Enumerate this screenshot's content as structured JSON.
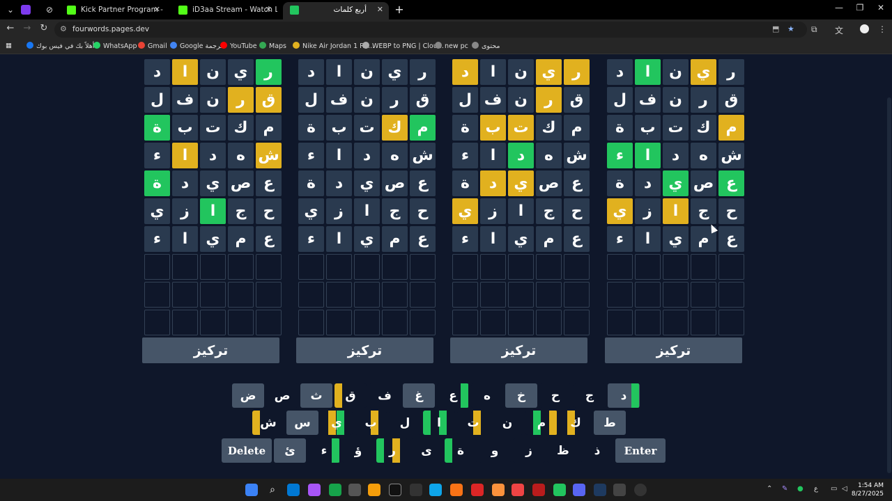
{
  "browser": {
    "tabs": [
      {
        "title": "Kick Partner Program - Kick Da",
        "active": false,
        "favicon_color": "#53fc18"
      },
      {
        "title": "iD3aa Stream - Watch Live on K",
        "active": false,
        "favicon_color": "#53fc18"
      },
      {
        "title": "أربع كلمات",
        "active": true,
        "favicon_color": "#22c55e"
      }
    ],
    "url": "fourwords.pages.dev",
    "bookmarks": [
      {
        "label": "أهلاً بك في فيس بوك",
        "color": "#1877f2"
      },
      {
        "label": "WhatsApp",
        "color": "#25d366"
      },
      {
        "label": "Gmail",
        "color": "#ea4335"
      },
      {
        "label": "Google ترجمة",
        "color": "#4285f4"
      },
      {
        "label": "YouTube",
        "color": "#ff0000"
      },
      {
        "label": "Maps",
        "color": "#34a853"
      },
      {
        "label": "Nike Air Jordan 1 Re...",
        "color": "#e1b11f"
      },
      {
        "label": "WEBP to PNG | Clou...",
        "color": "#aaaaaa"
      },
      {
        "label": "new pc",
        "color": "#888888"
      },
      {
        "label": "محتوى",
        "color": "#888888"
      }
    ]
  },
  "game": {
    "focus_label": "تركيز",
    "colors": {
      "yellow": "#e1b11f",
      "green": "#22c55e",
      "tile": "#2a3a4f",
      "used_key": "#465568"
    },
    "boards": [
      {
        "rows": [
          {
            "letters": [
              "ر",
              "ي",
              "ن",
              "ا",
              "د"
            ],
            "states": [
              "g",
              "n",
              "n",
              "y",
              "n"
            ]
          },
          {
            "letters": [
              "ق",
              "ر",
              "ن",
              "ف",
              "ل"
            ],
            "states": [
              "y",
              "y",
              "n",
              "n",
              "n"
            ]
          },
          {
            "letters": [
              "م",
              "ك",
              "ت",
              "ب",
              "ة"
            ],
            "states": [
              "n",
              "n",
              "n",
              "n",
              "g"
            ]
          },
          {
            "letters": [
              "ش",
              "ه",
              "د",
              "ا",
              "ء"
            ],
            "states": [
              "y",
              "n",
              "n",
              "y",
              "n"
            ]
          },
          {
            "letters": [
              "ع",
              "ص",
              "ي",
              "د",
              "ة"
            ],
            "states": [
              "n",
              "n",
              "n",
              "n",
              "g"
            ]
          },
          {
            "letters": [
              "ح",
              "ج",
              "ا",
              "ز",
              "ي"
            ],
            "states": [
              "n",
              "n",
              "g",
              "n",
              "n"
            ]
          },
          {
            "letters": [
              "ع",
              "م",
              "ي",
              "ا",
              "ء"
            ],
            "states": [
              "n",
              "n",
              "n",
              "n",
              "n"
            ]
          }
        ]
      },
      {
        "rows": [
          {
            "letters": [
              "ر",
              "ي",
              "ن",
              "ا",
              "د"
            ],
            "states": [
              "n",
              "n",
              "n",
              "n",
              "n"
            ]
          },
          {
            "letters": [
              "ق",
              "ر",
              "ن",
              "ف",
              "ل"
            ],
            "states": [
              "n",
              "n",
              "n",
              "n",
              "n"
            ]
          },
          {
            "letters": [
              "م",
              "ك",
              "ت",
              "ب",
              "ة"
            ],
            "states": [
              "g",
              "y",
              "n",
              "n",
              "n"
            ]
          },
          {
            "letters": [
              "ش",
              "ه",
              "د",
              "ا",
              "ء"
            ],
            "states": [
              "n",
              "n",
              "n",
              "n",
              "n"
            ]
          },
          {
            "letters": [
              "ع",
              "ص",
              "ي",
              "د",
              "ة"
            ],
            "states": [
              "n",
              "n",
              "n",
              "n",
              "n"
            ]
          },
          {
            "letters": [
              "ح",
              "ج",
              "ا",
              "ز",
              "ي"
            ],
            "states": [
              "n",
              "n",
              "n",
              "n",
              "n"
            ]
          },
          {
            "letters": [
              "ع",
              "م",
              "ي",
              "ا",
              "ء"
            ],
            "states": [
              "n",
              "n",
              "n",
              "n",
              "n"
            ]
          }
        ]
      },
      {
        "rows": [
          {
            "letters": [
              "ر",
              "ي",
              "ن",
              "ا",
              "د"
            ],
            "states": [
              "y",
              "y",
              "n",
              "n",
              "y"
            ]
          },
          {
            "letters": [
              "ق",
              "ر",
              "ن",
              "ف",
              "ل"
            ],
            "states": [
              "n",
              "y",
              "n",
              "n",
              "n"
            ]
          },
          {
            "letters": [
              "م",
              "ك",
              "ت",
              "ب",
              "ة"
            ],
            "states": [
              "n",
              "n",
              "y",
              "y",
              "n"
            ]
          },
          {
            "letters": [
              "ش",
              "ه",
              "د",
              "ا",
              "ء"
            ],
            "states": [
              "n",
              "n",
              "g",
              "n",
              "n"
            ]
          },
          {
            "letters": [
              "ع",
              "ص",
              "ي",
              "د",
              "ة"
            ],
            "states": [
              "n",
              "n",
              "y",
              "y",
              "n"
            ]
          },
          {
            "letters": [
              "ح",
              "ج",
              "ا",
              "ز",
              "ي"
            ],
            "states": [
              "n",
              "n",
              "n",
              "n",
              "y"
            ]
          },
          {
            "letters": [
              "ع",
              "م",
              "ي",
              "ا",
              "ء"
            ],
            "states": [
              "n",
              "n",
              "n",
              "n",
              "n"
            ]
          }
        ]
      },
      {
        "rows": [
          {
            "letters": [
              "ر",
              "ي",
              "ن",
              "ا",
              "د"
            ],
            "states": [
              "n",
              "y",
              "n",
              "g",
              "n"
            ]
          },
          {
            "letters": [
              "ق",
              "ر",
              "ن",
              "ف",
              "ل"
            ],
            "states": [
              "n",
              "n",
              "n",
              "n",
              "n"
            ]
          },
          {
            "letters": [
              "م",
              "ك",
              "ت",
              "ب",
              "ة"
            ],
            "states": [
              "y",
              "n",
              "n",
              "n",
              "n"
            ]
          },
          {
            "letters": [
              "ش",
              "ه",
              "د",
              "ا",
              "ء"
            ],
            "states": [
              "n",
              "n",
              "n",
              "g",
              "g"
            ]
          },
          {
            "letters": [
              "ع",
              "ص",
              "ي",
              "د",
              "ة"
            ],
            "states": [
              "g",
              "n",
              "g",
              "n",
              "n"
            ]
          },
          {
            "letters": [
              "ح",
              "ج",
              "ا",
              "ز",
              "ي"
            ],
            "states": [
              "n",
              "n",
              "y",
              "n",
              "y"
            ]
          },
          {
            "letters": [
              "ع",
              "م",
              "ي",
              "ا",
              "ء"
            ],
            "states": [
              "n",
              "n",
              "n",
              "n",
              "n"
            ]
          }
        ]
      }
    ],
    "empty_rows": 3,
    "keyboard": [
      [
        {
          "k": "د",
          "s": [
            "n",
            "n",
            "n",
            "g"
          ],
          "used": true
        },
        {
          "k": "ج",
          "s": [
            "n",
            "n",
            "n",
            "n"
          ],
          "used": false
        },
        {
          "k": "ح",
          "s": [
            "n",
            "n",
            "n",
            "n"
          ],
          "used": false
        },
        {
          "k": "خ",
          "s": [
            "n",
            "n",
            "n",
            "n"
          ],
          "used": true
        },
        {
          "k": "ه",
          "s": [
            "n",
            "n",
            "n",
            "n"
          ],
          "used": false
        },
        {
          "k": "ع",
          "s": [
            "n",
            "n",
            "n",
            "g"
          ],
          "used": false
        },
        {
          "k": "غ",
          "s": [
            "n",
            "n",
            "n",
            "n"
          ],
          "used": true
        },
        {
          "k": "ف",
          "s": [
            "n",
            "n",
            "n",
            "n"
          ],
          "used": false
        },
        {
          "k": "ق",
          "s": [
            "y",
            "n",
            "n",
            "n"
          ],
          "used": false
        },
        {
          "k": "ث",
          "s": [
            "n",
            "n",
            "n",
            "n"
          ],
          "used": true
        },
        {
          "k": "ص",
          "s": [
            "n",
            "n",
            "n",
            "n"
          ],
          "used": false
        },
        {
          "k": "ض",
          "s": [
            "n",
            "n",
            "n",
            "n"
          ],
          "used": true
        }
      ],
      [
        {
          "k": "ط",
          "s": [
            "n",
            "n",
            "n",
            "n"
          ],
          "used": true
        },
        {
          "k": "ك",
          "s": [
            "n",
            "y",
            "n",
            "n"
          ],
          "used": false
        },
        {
          "k": "م",
          "s": [
            "n",
            "g",
            "n",
            "y"
          ],
          "used": false
        },
        {
          "k": "ن",
          "s": [
            "n",
            "n",
            "n",
            "n"
          ],
          "used": false
        },
        {
          "k": "ت",
          "s": [
            "n",
            "n",
            "y",
            "n"
          ],
          "used": false
        },
        {
          "k": "ا",
          "s": [
            "g",
            "n",
            "g",
            "n"
          ],
          "used": false
        },
        {
          "k": "ل",
          "s": [
            "n",
            "n",
            "n",
            "n"
          ],
          "used": false
        },
        {
          "k": "ب",
          "s": [
            "n",
            "n",
            "y",
            "n"
          ],
          "used": false
        },
        {
          "k": "ي",
          "s": [
            "n",
            "y",
            "g",
            "n"
          ],
          "used": false
        },
        {
          "k": "س",
          "s": [
            "n",
            "n",
            "n",
            "n"
          ],
          "used": true
        },
        {
          "k": "ش",
          "s": [
            "y",
            "n",
            "n",
            "n"
          ],
          "used": false
        }
      ],
      [
        {
          "k": "ذ",
          "s": [
            "n",
            "n",
            "n",
            "n"
          ],
          "used": false
        },
        {
          "k": "ظ",
          "s": [
            "n",
            "n",
            "n",
            "n"
          ],
          "used": false
        },
        {
          "k": "ز",
          "s": [
            "n",
            "n",
            "n",
            "n"
          ],
          "used": false
        },
        {
          "k": "و",
          "s": [
            "n",
            "n",
            "n",
            "n"
          ],
          "used": false
        },
        {
          "k": "ة",
          "s": [
            "g",
            "n",
            "n",
            "n"
          ],
          "used": false
        },
        {
          "k": "ى",
          "s": [
            "n",
            "n",
            "n",
            "n"
          ],
          "used": false
        },
        {
          "k": "ر",
          "s": [
            "g",
            "n",
            "y",
            "n"
          ],
          "used": false
        },
        {
          "k": "ؤ",
          "s": [
            "n",
            "n",
            "n",
            "n"
          ],
          "used": false
        },
        {
          "k": "ء",
          "s": [
            "n",
            "n",
            "n",
            "g"
          ],
          "used": false
        },
        {
          "k": "ئ",
          "s": [
            "n",
            "n",
            "n",
            "n"
          ],
          "used": true
        }
      ]
    ],
    "enter_label": "Enter",
    "delete_label": "Delete"
  },
  "taskbar": {
    "time": "1:54 AM",
    "date": "8/27/2025",
    "lang": "ع"
  }
}
